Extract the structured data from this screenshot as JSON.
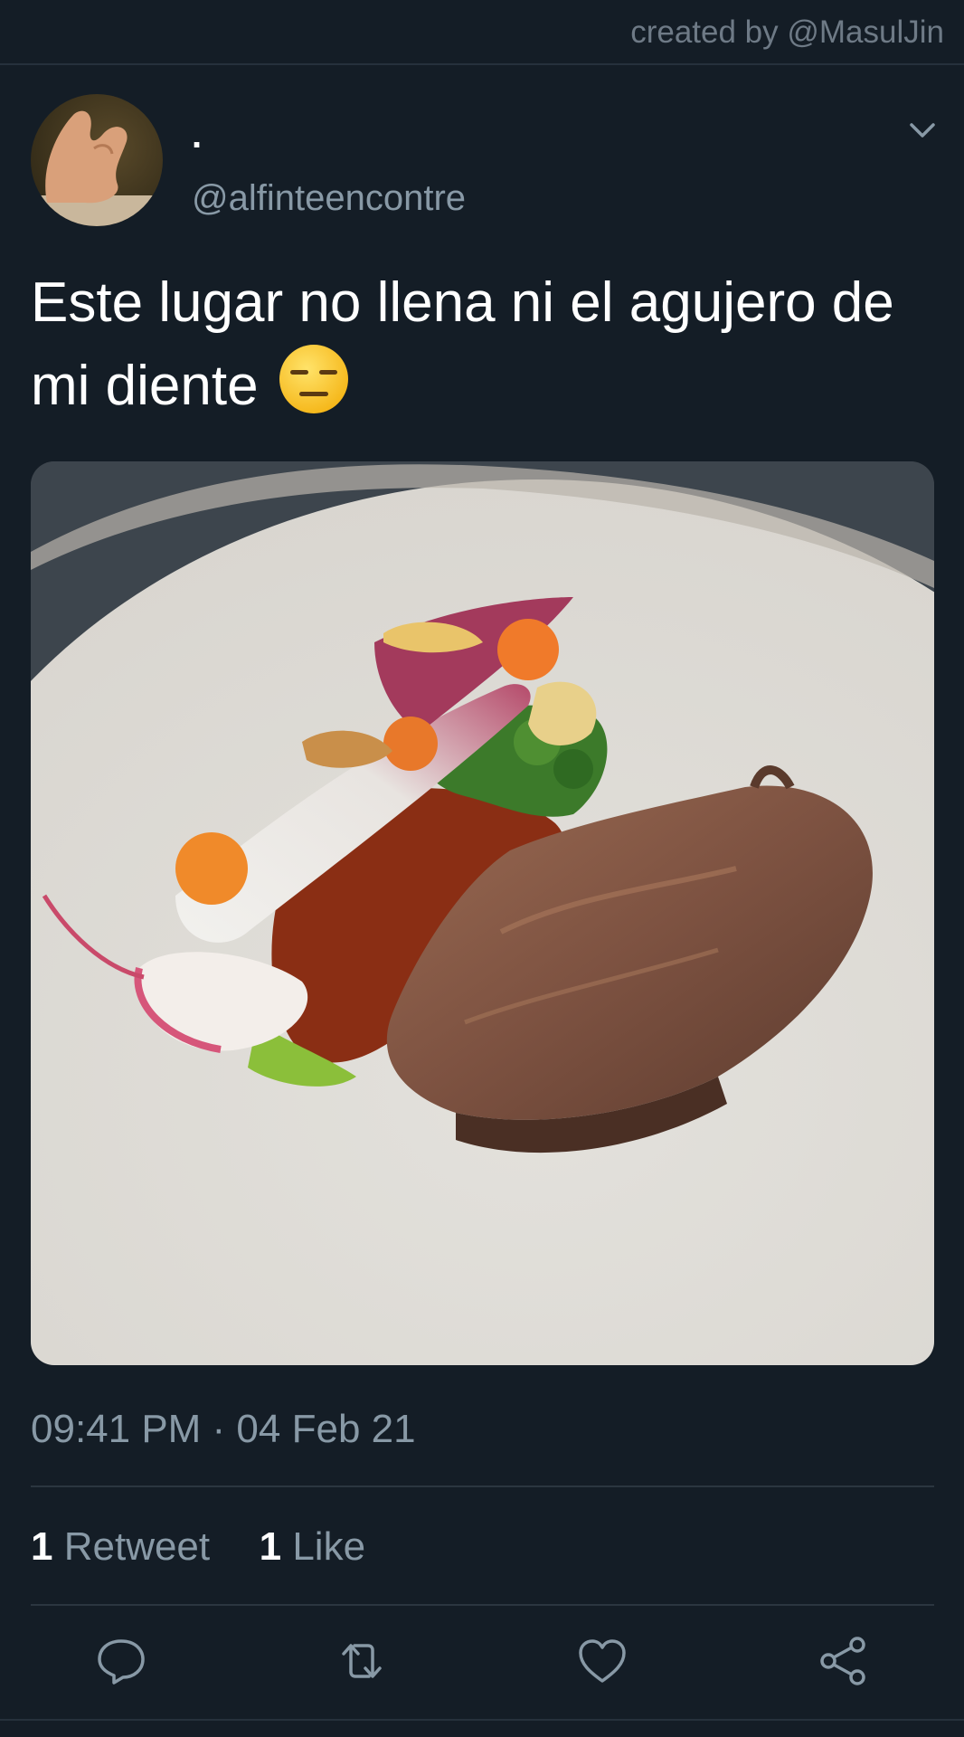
{
  "credit": "created by @MasulJin",
  "user": {
    "display_name": ".",
    "handle": "@alfinteencontre"
  },
  "tweet": {
    "text": "Este lugar no llena ni el agujero de mi diente",
    "emoji": "expressionless-face",
    "image_description": "plated dish"
  },
  "meta": {
    "timestamp": "09:41 PM · 04 Feb 21"
  },
  "stats": {
    "retweets_count": "1",
    "retweets_label": "Retweet",
    "likes_count": "1",
    "likes_label": "Like"
  },
  "actions": [
    "reply-icon",
    "retweet-icon",
    "like-icon",
    "share-icon"
  ],
  "colors": {
    "background": "#141d26",
    "secondary_text": "#8899a6",
    "divider": "#2b3640"
  }
}
